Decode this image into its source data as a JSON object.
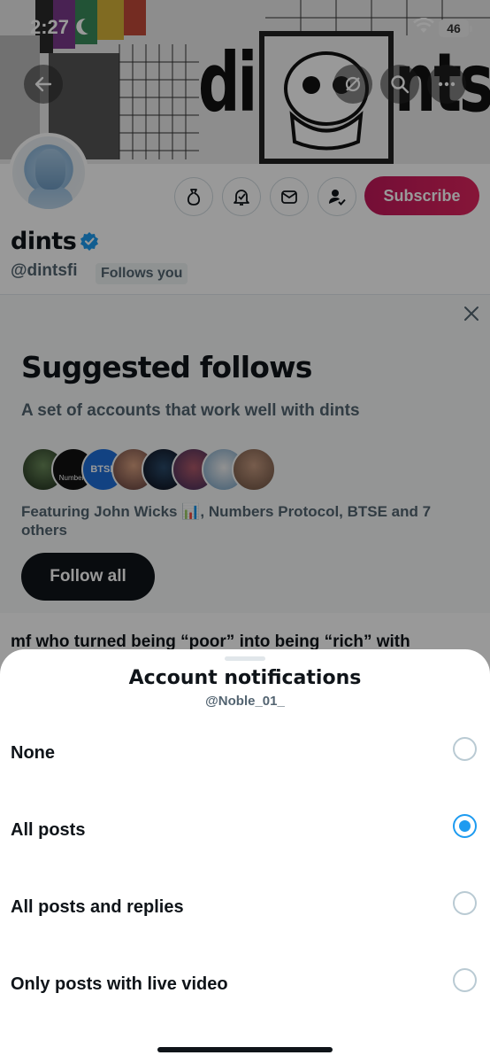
{
  "status_bar": {
    "time": "2:27",
    "battery": "46"
  },
  "banner": {
    "text_left": "di",
    "text_right": "nts"
  },
  "profile": {
    "name": "dints",
    "handle": "@dintsfi",
    "follows_you": "Follows you",
    "subscribe_label": "Subscribe",
    "action_icons": [
      "tip-icon",
      "notification-bell-icon",
      "message-icon",
      "following-icon"
    ]
  },
  "suggested": {
    "title": "Suggested follows",
    "subtitle": "A set of accounts that work well with dints",
    "featuring": "Featuring John Wicks 📊, Numbers Protocol, BTSE and 7 others",
    "follow_all": "Follow all",
    "avatar_labels": [
      "",
      "Numbers",
      "BTSE",
      "",
      "",
      "",
      "",
      ""
    ]
  },
  "tweet_preview": "mf who turned being “poor” into being “rich” with",
  "sheet": {
    "title": "Account notifications",
    "subtitle": "@Noble_01_",
    "options": [
      {
        "label": "None",
        "selected": false
      },
      {
        "label": "All posts",
        "selected": true
      },
      {
        "label": "All posts and replies",
        "selected": false
      },
      {
        "label": "Only posts with live video",
        "selected": false
      }
    ]
  },
  "colors": {
    "accent": "#1d9bf0",
    "subscribe": "#e0245e",
    "text": "#0f1419",
    "secondary": "#536471"
  }
}
